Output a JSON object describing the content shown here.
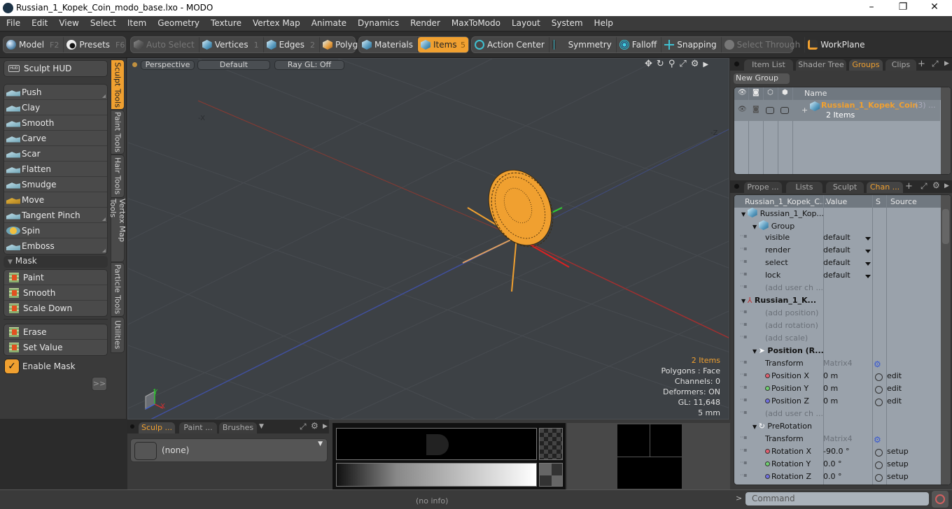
{
  "window": {
    "title": "Russian_1_Kopek_Coin_modo_base.lxo - MODO",
    "minimize": "–",
    "maximize": "❐",
    "close": "✕"
  },
  "menu": [
    "File",
    "Edit",
    "View",
    "Select",
    "Item",
    "Geometry",
    "Texture",
    "Vertex Map",
    "Animate",
    "Dynamics",
    "Render",
    "MaxToModo",
    "Layout",
    "System",
    "Help"
  ],
  "toolbar": {
    "model": {
      "label": "Model",
      "key": "F2"
    },
    "presets": {
      "label": "Presets",
      "key": "F6"
    },
    "auto_select": "Auto Select",
    "vertices": {
      "label": "Vertices",
      "key": "1"
    },
    "edges": {
      "label": "Edges",
      "key": "2"
    },
    "polygons": {
      "label": "Polygons"
    },
    "materials": "Materials",
    "items": {
      "label": "Items",
      "key": "5"
    },
    "action_center": "Action Center",
    "symmetry": "Symmetry",
    "falloff": "Falloff",
    "snapping": "Snapping",
    "select_through": "Select Through",
    "workplane": "WorkPlane"
  },
  "left_panel": {
    "sculpt_hud": "Sculpt HUD",
    "sculpt_tools": [
      "Push",
      "Clay",
      "Smooth",
      "Carve",
      "Scar",
      "Flatten",
      "Smudge",
      "Move",
      "Tangent Pinch",
      "Spin",
      "Emboss"
    ],
    "mask_header": "Mask",
    "mask_tools": [
      "Paint",
      "Smooth",
      "Scale Down"
    ],
    "mask_tools2": [
      "Erase",
      "Set Value"
    ],
    "enable_mask": {
      "label": "Enable Mask",
      "checked": true
    },
    "more_button": ">>",
    "vertical_tabs": [
      "Sculpt Tools",
      "Paint Tools",
      "Hair Tools",
      "Vertex Map Tools",
      "Particle Tools",
      "Utilities"
    ]
  },
  "viewport": {
    "view_mode": "Perspective",
    "shading": "Default",
    "raygl": "Ray GL: Off",
    "axis_neg_x": "-X",
    "axis_neg_z": "-Z",
    "info": {
      "items": "2 Items",
      "polygons": "Polygons : Face",
      "channels": "Channels: 0",
      "deformers": "Deformers: ON",
      "gl": "GL: 11,648",
      "unit": "5 mm"
    },
    "accent": "#f0a030"
  },
  "groups_panel": {
    "tabs": [
      "Item List",
      "Shader Tree",
      "Groups",
      "Clips"
    ],
    "active_tab": "Groups",
    "new_group": "New Group",
    "column_name": "Name",
    "group": {
      "name": "Russian_1_Kopek_Coin",
      "count": "(3) ...",
      "items": "2 Items"
    }
  },
  "channels_panel": {
    "tabs": [
      "Prope ...",
      "Lists",
      "Sculpt",
      "Chan ..."
    ],
    "active_tab": "Chan ...",
    "columns": [
      "Russian_1_Kopek_C...",
      "Value",
      "S",
      "Source"
    ],
    "rows": [
      {
        "name": "Russian_1_Kop...",
        "indent": 0,
        "kind": "item"
      },
      {
        "name": "Group",
        "indent": 1,
        "kind": "group"
      },
      {
        "name": "visible",
        "value": "default",
        "dropdown": true,
        "indent": 2
      },
      {
        "name": "render",
        "value": "default",
        "dropdown": true,
        "indent": 2
      },
      {
        "name": "select",
        "value": "default",
        "dropdown": true,
        "indent": 2
      },
      {
        "name": "lock",
        "value": "default",
        "dropdown": true,
        "indent": 2
      },
      {
        "name": "(add user ch ...",
        "indent": 2,
        "dim": true
      },
      {
        "name": "Russian_1_K...",
        "indent": 0,
        "kind": "locator",
        "bold": true
      },
      {
        "name": "(add position)",
        "indent": 1,
        "dim": true
      },
      {
        "name": "(add rotation)",
        "indent": 1,
        "dim": true
      },
      {
        "name": "(add scale)",
        "indent": 1,
        "dim": true
      },
      {
        "name": "Position (R...",
        "indent": 1,
        "bold": true,
        "kind": "transform"
      },
      {
        "name": "Transform",
        "value": "Matrix4",
        "value_dim": true,
        "gear": true,
        "indent": 2
      },
      {
        "name": "Position X",
        "value": "0 m",
        "source": "edit",
        "dot": "#e06070",
        "indent": 2
      },
      {
        "name": "Position Y",
        "value": "0 m",
        "source": "edit",
        "dot": "#70d070",
        "indent": 2
      },
      {
        "name": "Position Z",
        "value": "0 m",
        "source": "edit",
        "dot": "#7070e0",
        "indent": 2
      },
      {
        "name": "(add user ch ...",
        "indent": 2,
        "dim": true
      },
      {
        "name": "PreRotation",
        "indent": 1,
        "kind": "rotation"
      },
      {
        "name": "Transform",
        "value": "Matrix4",
        "value_dim": true,
        "gear": true,
        "indent": 2
      },
      {
        "name": "Rotation X",
        "value": "-90.0 °",
        "source": "setup",
        "dot": "#e06070",
        "indent": 2
      },
      {
        "name": "Rotation Y",
        "value": "0.0 °",
        "source": "setup",
        "dot": "#70d070",
        "indent": 2
      },
      {
        "name": "Rotation Z",
        "value": "0.0 °",
        "source": "setup",
        "dot": "#7070e0",
        "indent": 2
      }
    ]
  },
  "bottom_panel": {
    "tabs": [
      "Sculp ...",
      "Paint ...",
      "Brushes"
    ],
    "active_tab": "Sculp ...",
    "brush_preset": "(none)"
  },
  "statusbar": {
    "info": "(no info)",
    "command_prompt": ">",
    "command_placeholder": "Command"
  }
}
